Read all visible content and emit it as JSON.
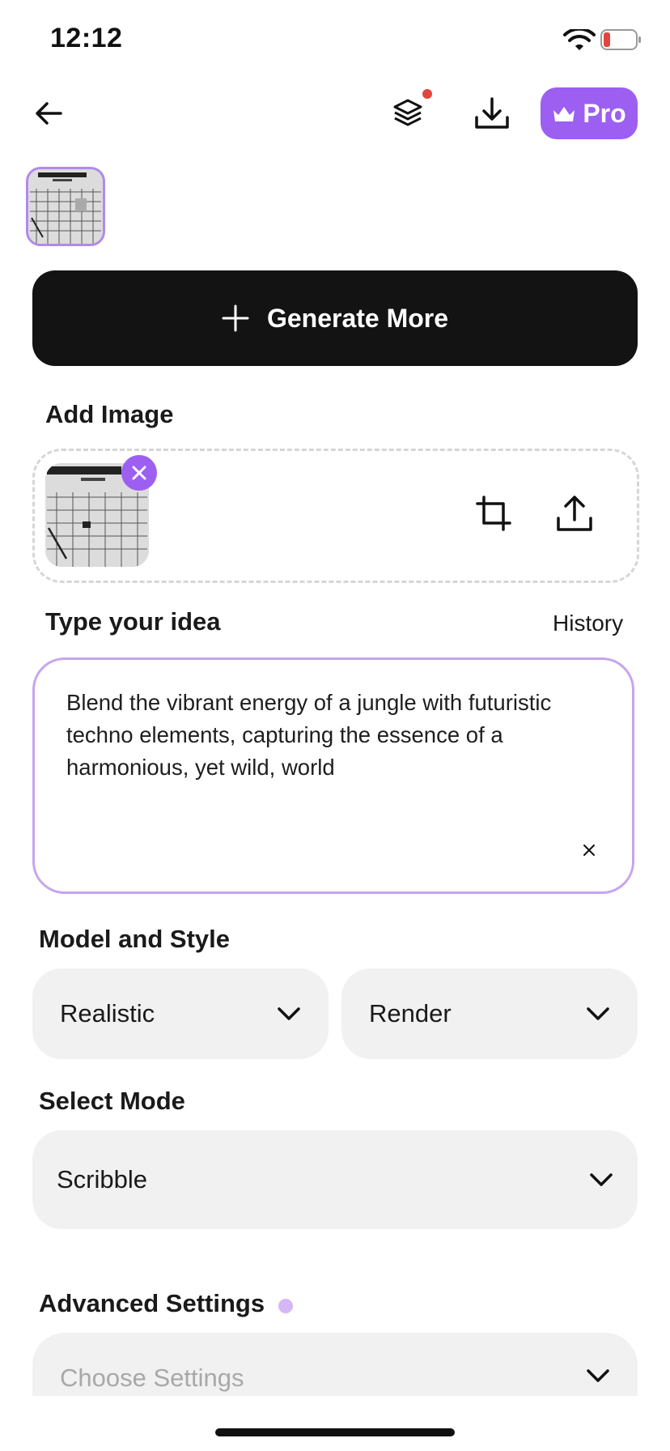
{
  "status_bar": {
    "time": "12:12"
  },
  "nav": {
    "pro_label": "Pro",
    "notification": true
  },
  "generate_button": {
    "label": "Generate More"
  },
  "add_image": {
    "label": "Add Image"
  },
  "idea": {
    "label": "Type your idea",
    "history_label": "History",
    "text": "Blend the vibrant energy of a jungle with futuristic techno elements, capturing the essence of a harmonious, yet wild, world"
  },
  "model_style": {
    "label": "Model and Style",
    "model_value": "Realistic",
    "style_value": "Render"
  },
  "mode": {
    "label": "Select Mode",
    "value": "Scribble"
  },
  "advanced": {
    "label": "Advanced Settings",
    "placeholder": "Choose Settings"
  },
  "colors": {
    "accent": "#9c5ff2",
    "accent_light": "#c7a4ef",
    "dark_button": "#131313",
    "notification_dot": "#e2453d"
  }
}
